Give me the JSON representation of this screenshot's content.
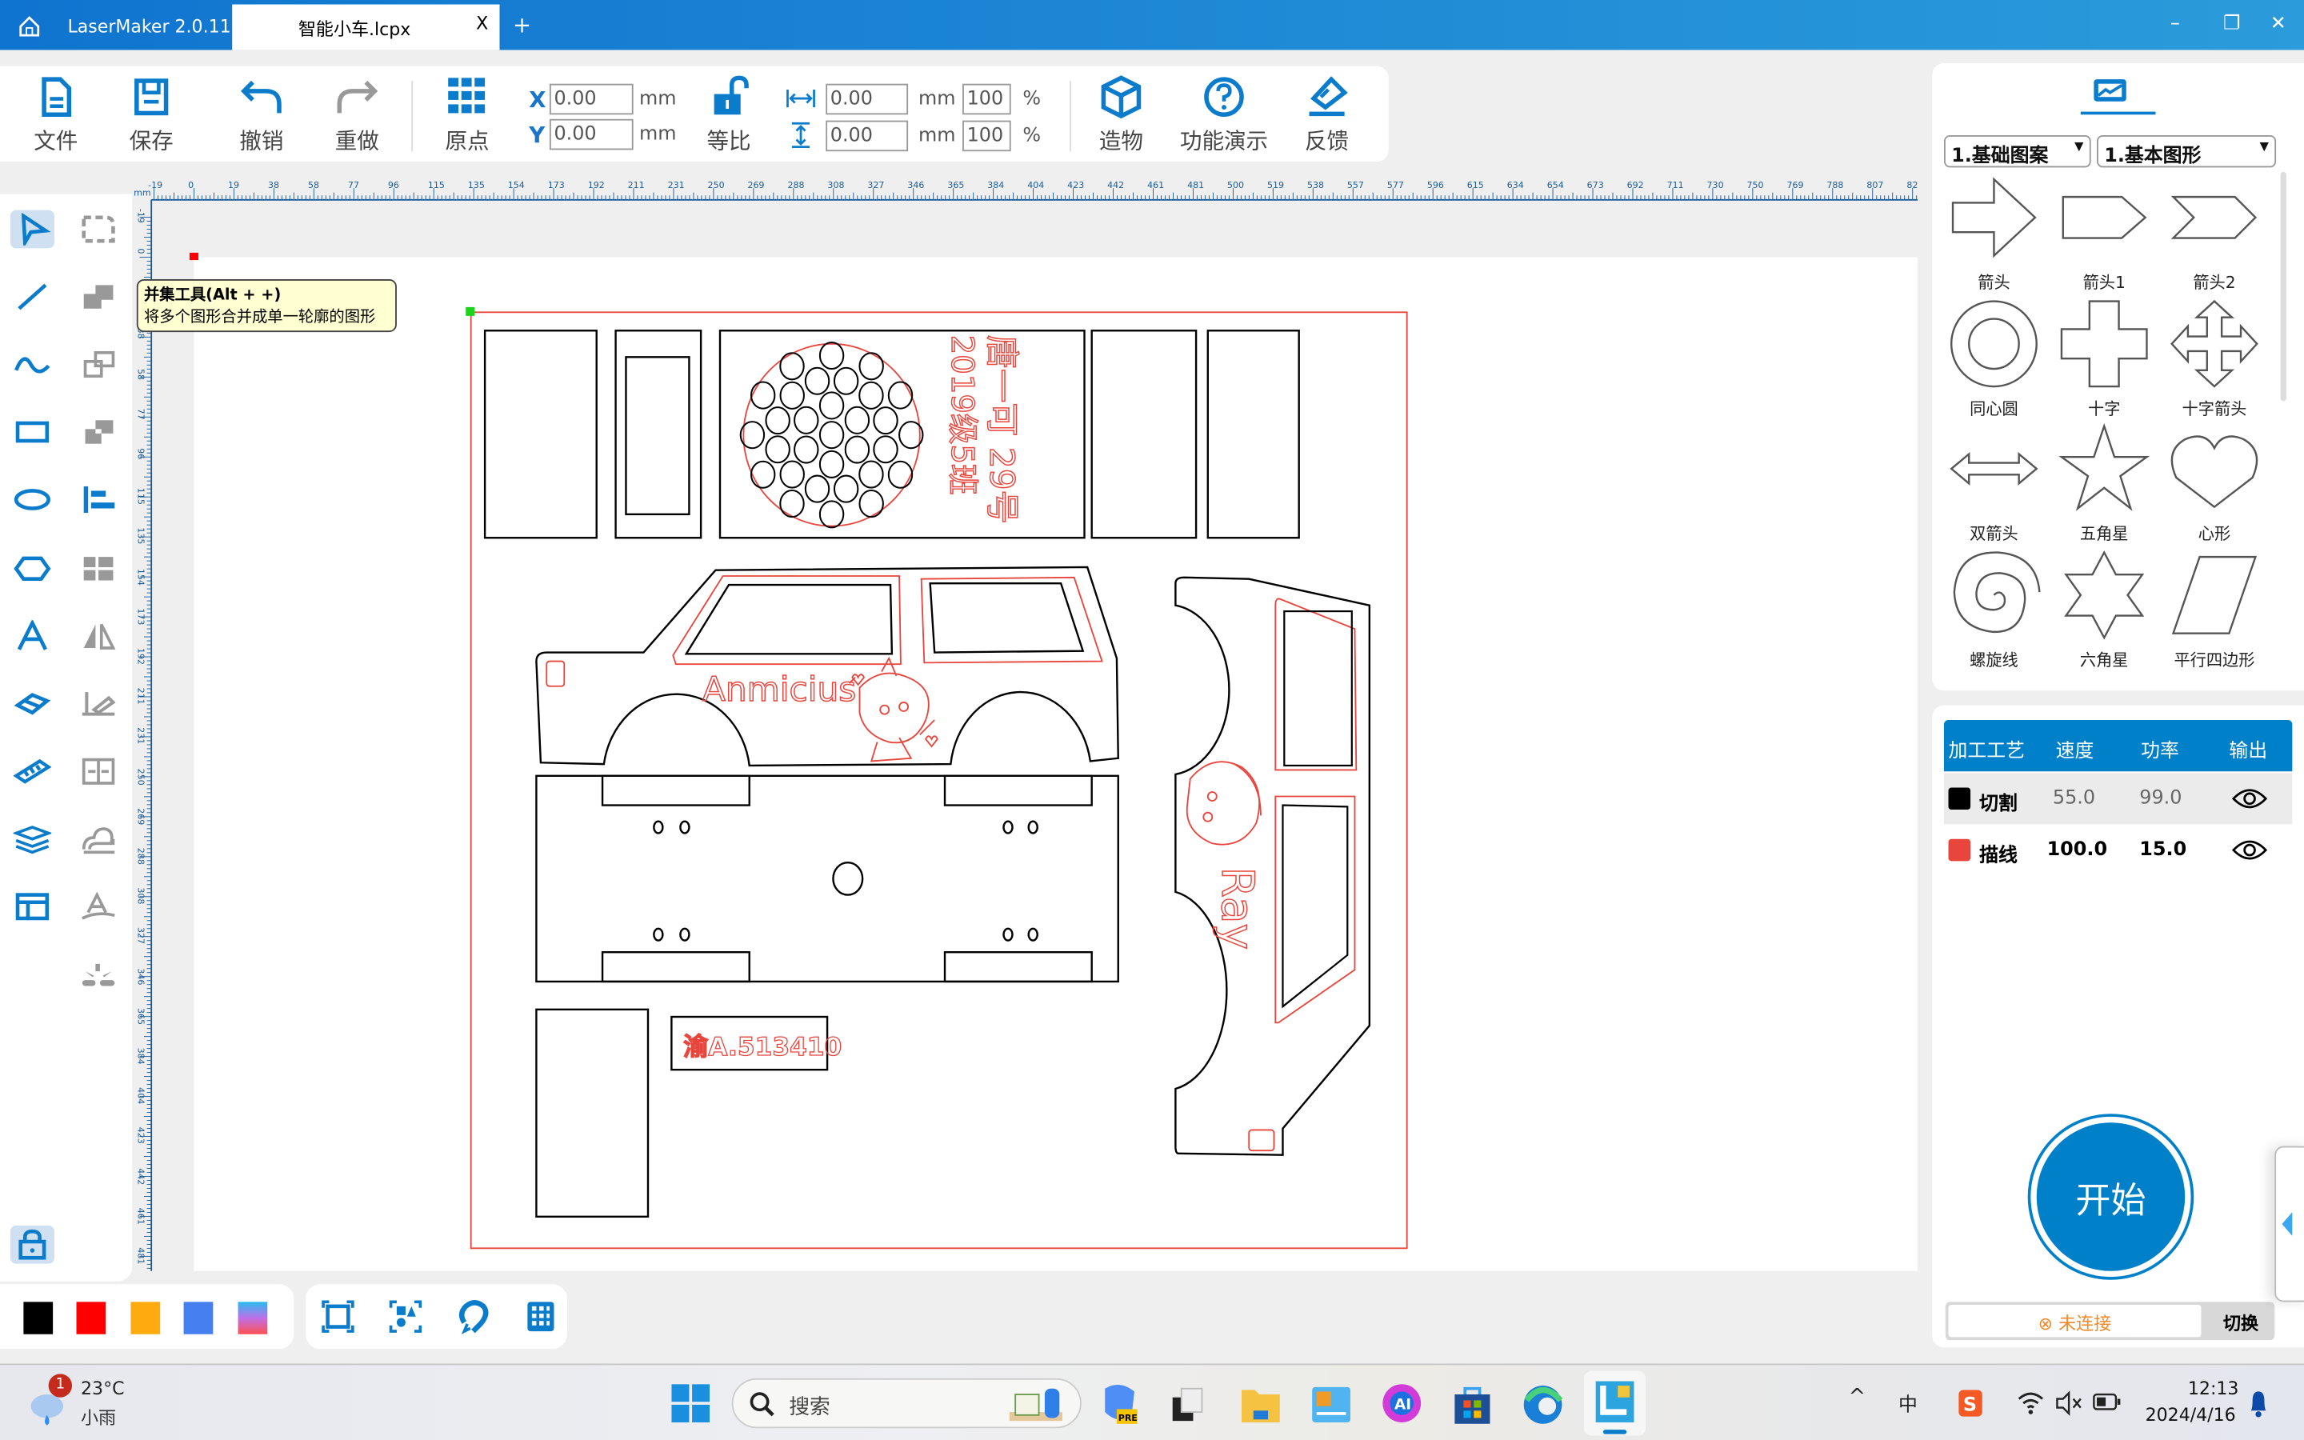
{
  "titlebar": {
    "app_name": "LaserMaker 2.0.11",
    "tab_title": "智能小车.lcpx",
    "tab_close": "X",
    "new_tab": "+",
    "minimize": "–",
    "restore": "❐",
    "close": "✕"
  },
  "toolbar": {
    "file": "文件",
    "save": "保存",
    "undo": "撤销",
    "redo": "重做",
    "origin": "原点",
    "x_label": "X",
    "y_label": "Y",
    "x_value": "0.00",
    "y_value": "0.00",
    "unit_mm": "mm",
    "lock_ratio": "等比",
    "width_value": "0.00",
    "height_value": "0.00",
    "width_pct": "100",
    "height_pct": "100",
    "pct": "%",
    "create": "造物",
    "demo": "功能演示",
    "feedback": "反馈"
  },
  "tooltip": {
    "title": "并集工具(Alt + +)",
    "desc": "将多个图形合并成单一轮廓的图形"
  },
  "rulers": {
    "unit": "mm",
    "h_labels": [
      "-19",
      "0",
      "19",
      "38",
      "58",
      "77",
      "96",
      "115",
      "135",
      "154",
      "173",
      "192",
      "211",
      "231",
      "250",
      "269",
      "288",
      "308",
      "327",
      "346",
      "365",
      "384",
      "404",
      "423",
      "442",
      "461",
      "481",
      "500",
      "519",
      "538",
      "557",
      "577",
      "596",
      "615",
      "634",
      "654",
      "673",
      "692",
      "711",
      "730",
      "750",
      "769",
      "788",
      "807",
      "82"
    ],
    "v_labels": [
      "-19",
      "0",
      "19",
      "38",
      "58",
      "77",
      "96",
      "115",
      "135",
      "154",
      "173",
      "192",
      "211",
      "231",
      "250",
      "269",
      "288",
      "308",
      "327",
      "346",
      "365",
      "384",
      "404",
      "423",
      "442",
      "461",
      "481"
    ]
  },
  "canvas": {
    "name_text": "唐一可 29号",
    "class_text": "2019级5班",
    "car_text": "Anmicius",
    "plate_text": "渝A.513410",
    "side_text": "Ray",
    "cut_color": "#000000",
    "line_color": "#e8453c"
  },
  "shapes_panel": {
    "category": "1.基础图案",
    "subcategory": "1.基本图形",
    "items": [
      {
        "label": "箭头",
        "icon": "arrow"
      },
      {
        "label": "箭头1",
        "icon": "arrow-tag"
      },
      {
        "label": "箭头2",
        "icon": "chevron"
      },
      {
        "label": "同心圆",
        "icon": "concentric-circles"
      },
      {
        "label": "十字",
        "icon": "cross"
      },
      {
        "label": "十字箭头",
        "icon": "cross-arrows"
      },
      {
        "label": "双箭头",
        "icon": "double-arrow"
      },
      {
        "label": "五角星",
        "icon": "star5"
      },
      {
        "label": "心形",
        "icon": "heart"
      },
      {
        "label": "螺旋线",
        "icon": "spiral"
      },
      {
        "label": "六角星",
        "icon": "star6"
      },
      {
        "label": "平行四边形",
        "icon": "parallelogram"
      }
    ]
  },
  "process": {
    "headers": [
      "加工工艺",
      "速度",
      "功率",
      "输出"
    ],
    "rows": [
      {
        "color": "#000000",
        "name": "切割",
        "speed": "55.0",
        "power": "99.0"
      },
      {
        "color": "#e8453c",
        "name": "描线",
        "speed": "100.0",
        "power": "15.0"
      }
    ],
    "start": "开始",
    "status": "未连接",
    "switch": "切换",
    "accent": "#0080c8"
  },
  "palette": [
    "#000000",
    "#ff0000",
    "#ffab0f",
    "#4680f0",
    "gradient"
  ],
  "taskbar": {
    "weather_temp": "23°C",
    "weather_desc": "小雨",
    "weather_badge": "1",
    "search": "搜索",
    "ime": "中",
    "time": "12:13",
    "date": "2024/4/16"
  }
}
